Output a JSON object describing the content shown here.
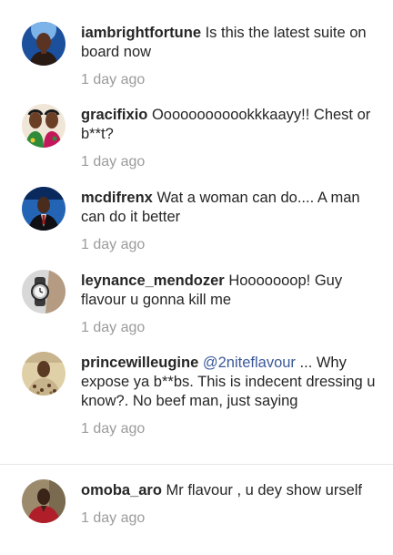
{
  "comments": [
    {
      "username": "iambrightfortune",
      "text": " Is this the latest suite on board now",
      "time": "1 day ago",
      "avatar_icon": "profile-photo-man-blue-background",
      "avatar_colors": [
        "#1c4f9c",
        "#7cb3e8",
        "#2a1a14"
      ]
    },
    {
      "username": "gracifixio",
      "text": " Oooooooooookkkaayy!! Chest or b**t?",
      "time": "1 day ago",
      "avatar_icon": "profile-photo-two-women",
      "avatar_colors": [
        "#f0e6d8",
        "#2e8b3a",
        "#c2185b"
      ]
    },
    {
      "username": "mcdifrenx",
      "text": " Wat a woman can do.... A man can do it better",
      "time": "1 day ago",
      "avatar_icon": "profile-photo-man-suit",
      "avatar_colors": [
        "#0a2a5e",
        "#2464b4",
        "#e8e8e8"
      ]
    },
    {
      "username": "leynance_mendozer",
      "text": " Hooooooop! Guy flavour u gonna kill me",
      "time": "1 day ago",
      "avatar_icon": "profile-photo-wristwatch",
      "avatar_colors": [
        "#d8d8d8",
        "#3a3a3a",
        "#b59b82"
      ]
    },
    {
      "username": "princewilleugine",
      "mention": "@2niteflavour",
      "text": " ... Why expose ya b**bs. This is indecent dressing u know?. No beef man, just saying",
      "time": "1 day ago",
      "avatar_icon": "profile-photo-man-patterned-shirt",
      "avatar_colors": [
        "#c8b48c",
        "#5a3a22",
        "#e0d0a8"
      ]
    },
    {
      "username": "omoba_aro",
      "text": " Mr flavour , u dey show urself",
      "time": "1 day ago",
      "avatar_icon": "profile-photo-man-red-shirt",
      "avatar_colors": [
        "#9c8a6c",
        "#b01e2a",
        "#3a2418"
      ]
    }
  ]
}
